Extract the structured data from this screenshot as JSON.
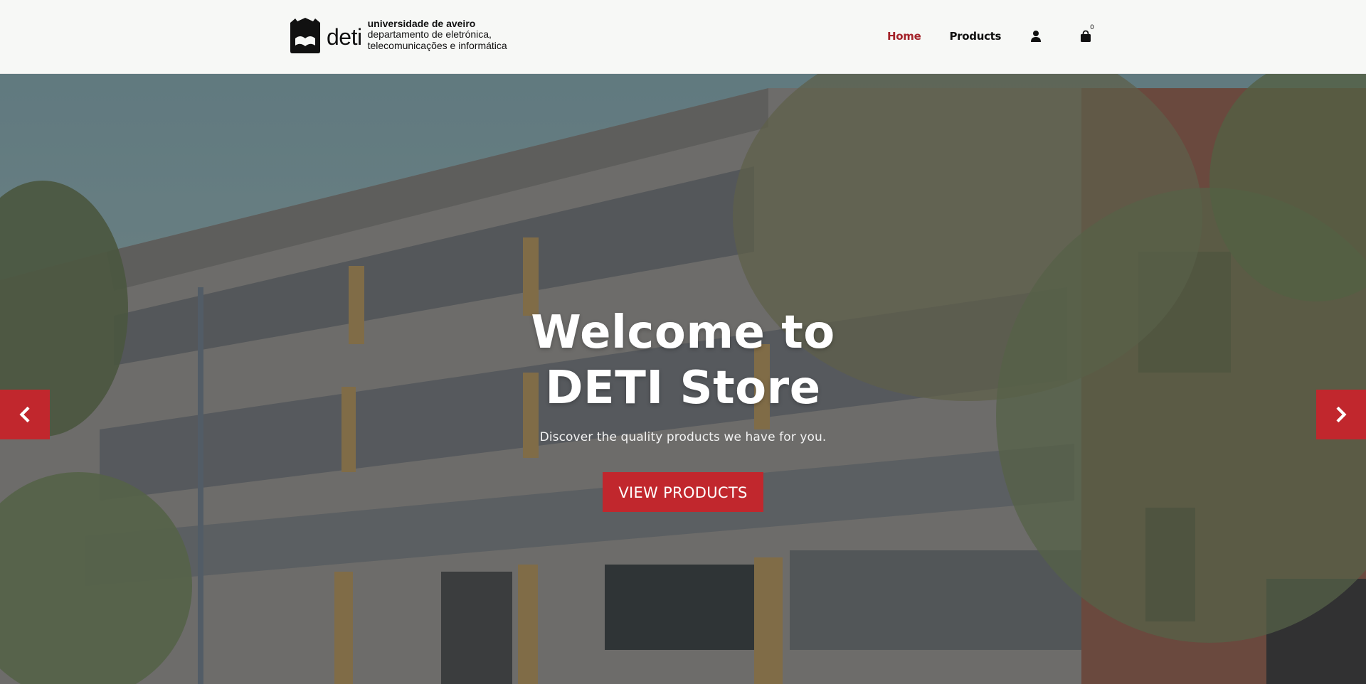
{
  "header": {
    "logo": {
      "word": "deti",
      "line1": "universidade de aveiro",
      "line2": "departamento de eletrónica,",
      "line3": "telecomunicações e informática"
    },
    "nav": {
      "home": "Home",
      "products": "Products",
      "user_icon": "user-icon",
      "cart_icon": "shopping-bag-icon",
      "cart_count": "0"
    }
  },
  "hero": {
    "title_line1": "Welcome to",
    "title_line2": "DETI Store",
    "subtitle": "Discover the quality products we have for you.",
    "button_label": "VIEW PRODUCTS",
    "prev_icon": "chevron-left-icon",
    "next_icon": "chevron-right-icon"
  },
  "colors": {
    "accent": "#c1272d",
    "active_nav": "#a4232a",
    "header_bg": "#f7f8f6",
    "text_dark": "#111111"
  }
}
